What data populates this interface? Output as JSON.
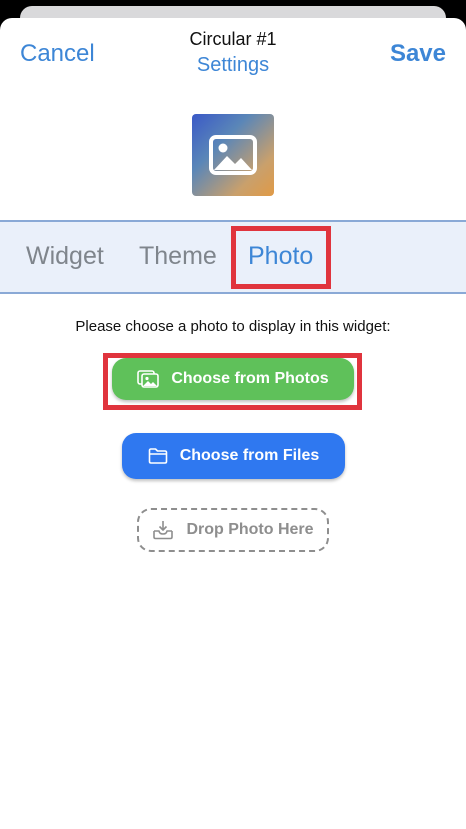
{
  "header": {
    "cancel_label": "Cancel",
    "title": "Circular #1",
    "subtitle": "Settings",
    "save_label": "Save"
  },
  "preview": {
    "icon": "image-icon"
  },
  "tabs": [
    {
      "label": "Widget",
      "selected": false
    },
    {
      "label": "Theme",
      "selected": false
    },
    {
      "label": "Photo",
      "selected": true
    }
  ],
  "photo_panel": {
    "instruction": "Please choose a photo to display in this widget:",
    "choose_photos_label": "Choose from Photos",
    "choose_files_label": "Choose from Files",
    "drop_label": "Drop Photo Here"
  },
  "colors": {
    "accent": "#3d86d6",
    "photos_button": "#5fc15a",
    "files_button": "#2f78f0",
    "highlight": "#e0343d"
  }
}
